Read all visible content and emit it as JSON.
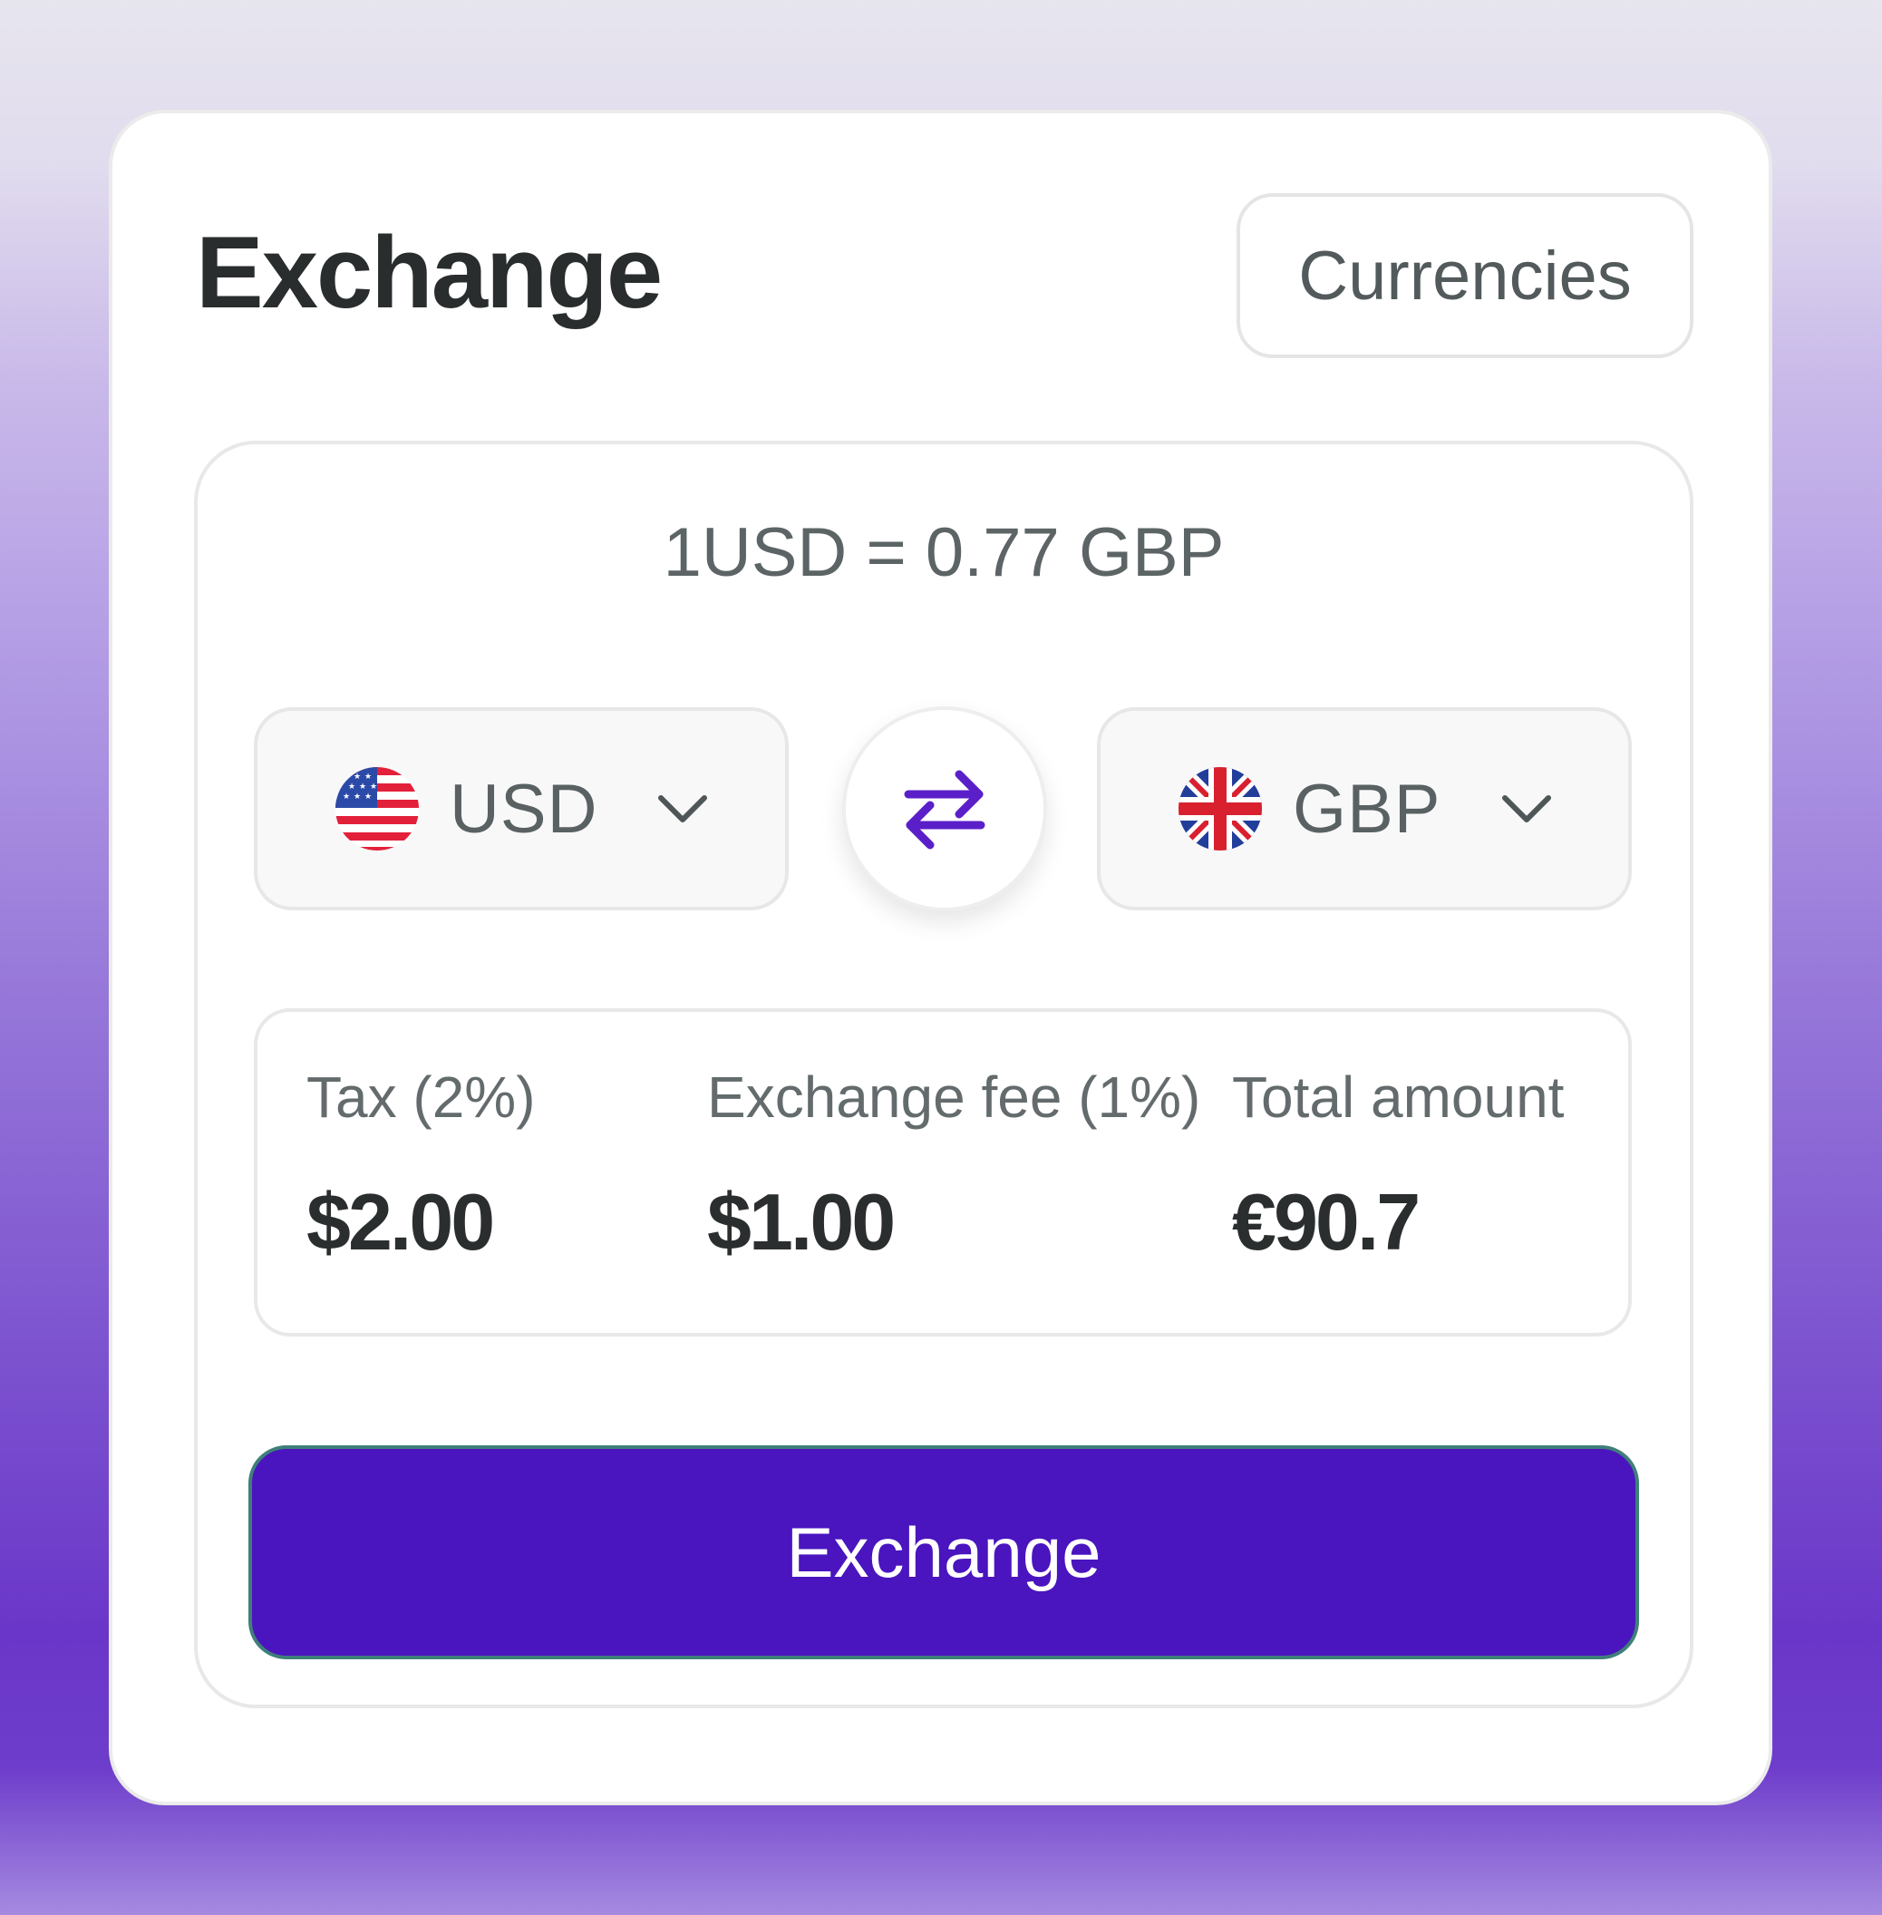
{
  "header": {
    "title": "Exchange",
    "currencies_button_label": "Currencies"
  },
  "converter": {
    "rate_text": "1USD = 0.77 GBP",
    "from": {
      "code": "USD",
      "flag_icon": "us-flag-icon"
    },
    "to": {
      "code": "GBP",
      "flag_icon": "uk-flag-icon"
    },
    "swap_icon": "swap-arrows-icon",
    "dropdown_icon": "chevron-down-icon"
  },
  "summary": {
    "tax": {
      "label": "Tax (2%)",
      "value": "$2.00"
    },
    "fee": {
      "label": "Exchange fee (1%)",
      "value": "$1.00"
    },
    "total": {
      "label": "Total amount",
      "value": "€90.7"
    }
  },
  "action": {
    "exchange_label": "Exchange"
  },
  "colors": {
    "accent": "#4a14bf",
    "swap_icon": "#5a1fc9",
    "text_dark": "#2a2d2e",
    "text_muted": "#5d6466"
  }
}
